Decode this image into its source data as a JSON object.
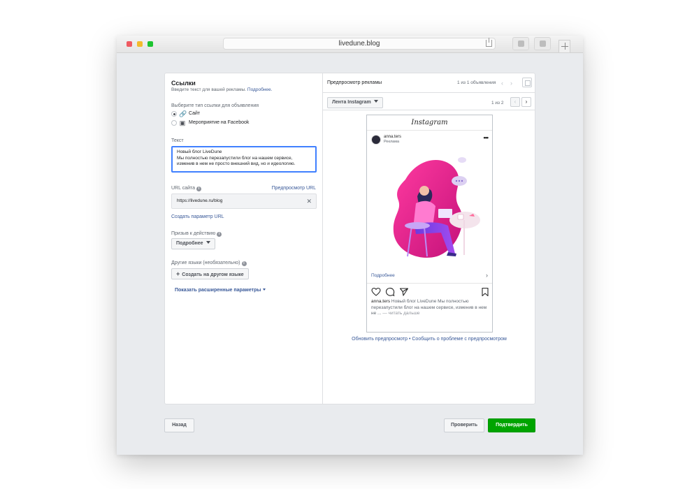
{
  "browser": {
    "url": "livedune.blog"
  },
  "left": {
    "title": "Ссылки",
    "subtitle": "Введите текст для вашей рекламы.",
    "subtitle_link": "Подробнее.",
    "link_type_label": "Выберите тип ссылки для объявления",
    "link_types": [
      {
        "label": "Сайт",
        "selected": true,
        "icon": "link-icon"
      },
      {
        "label": "Мероприятие на Facebook",
        "selected": false,
        "icon": "calendar-icon"
      }
    ],
    "text_label": "Текст",
    "text_value_line1": "Новый блог LiveDune",
    "text_value_line2": "Мы полностью перезапустили блог на нашем сервисе, изменив в нем не просто внешний вид, но и идеологию.",
    "url_label": "URL сайта",
    "url_preview_link": "Предпросмотр URL",
    "url_value": "https://livedune.ru/blog",
    "create_param": "Создать параметр URL",
    "cta_label": "Призыв к действию",
    "cta_value": "Подробнее",
    "other_lang_label": "Другие языки (необязательно)",
    "create_lang_btn": "Создать на другом языке",
    "advanced": "Показать расширенные параметры"
  },
  "preview": {
    "title": "Предпросмотр рекламы",
    "ad_count": "1 из 1 объявления",
    "placement": "Лента Instagram",
    "page_count": "1 из 2",
    "ig_logo": "Instagram",
    "username": "anna.ters",
    "sponsored": "Реклама",
    "learn_more": "Подробнее",
    "caption_user": "anna.ters",
    "caption_text": "Новый блог LiveDune Мы полностью перезапустили блог на нашем сервисе, изменив в нем не ...",
    "read_more": "— читать дальше",
    "footer_refresh": "Обновить предпросмотр",
    "footer_sep": " • ",
    "footer_report": "Сообщить о проблеме с предпросмотром"
  },
  "buttons": {
    "back": "Назад",
    "check": "Проверить",
    "confirm": "Подтвердить"
  },
  "colors": {
    "accent": "#4080ff",
    "link": "#385898",
    "confirm": "#00a400",
    "art_pink": "#e8177f",
    "art_purple": "#7b3fe4"
  }
}
